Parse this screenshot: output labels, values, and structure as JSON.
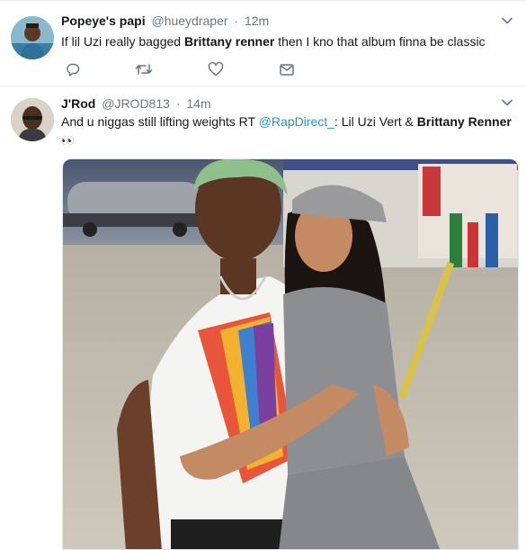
{
  "tweets": [
    {
      "name": "Popeye's papi",
      "handle": "@hueydraper",
      "separator": "·",
      "time": "12m",
      "text_before": "If lil Uzi really bagged ",
      "text_bold": "Brittany renner",
      "text_after": " then I kno that album finna be classic",
      "avatar_icon": "user-avatar",
      "actions": [
        "reply-icon",
        "retweet-icon",
        "like-icon",
        "message-icon"
      ]
    },
    {
      "name": "J'Rod",
      "handle": "@JROD813",
      "separator": "·",
      "time": "14m",
      "text_before": "And u niggas still lifting weights RT ",
      "mention": "@RapDirect_",
      "text_middle": ": Lil Uzi Vert & ",
      "text_bold": "Brittany Renner",
      "emoji": "👀",
      "avatar_icon": "user-avatar",
      "media_icon": "photo-image"
    }
  ],
  "colors": {
    "link": "#1b95e0",
    "secondary_text": "#657786",
    "border": "#e6ecf0",
    "icon": "#657786"
  }
}
